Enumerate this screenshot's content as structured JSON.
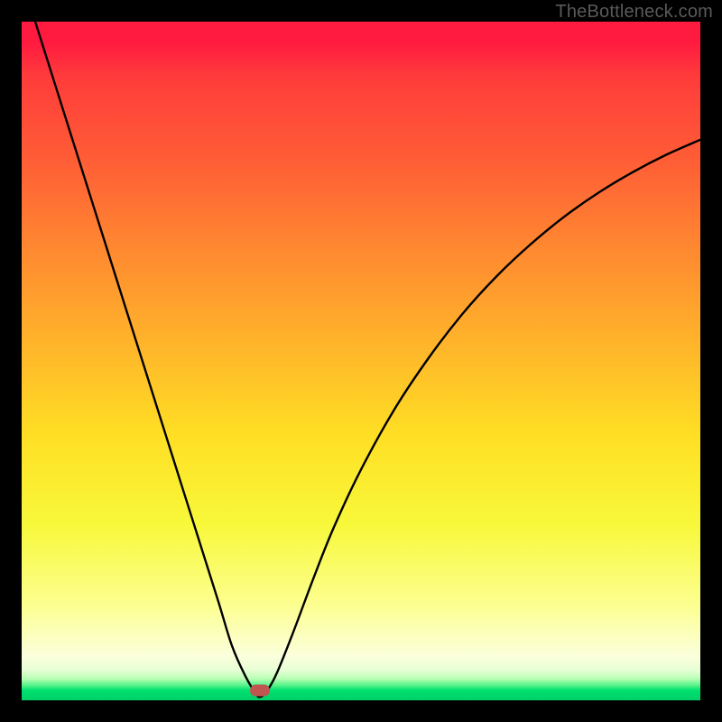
{
  "watermark": "TheBottleneck.com",
  "marker": {
    "x_pct": 35.1,
    "y_pct": 98.6
  },
  "chart_data": {
    "type": "line",
    "title": "",
    "xlabel": "",
    "ylabel": "",
    "xlim": [
      0,
      100
    ],
    "ylim": [
      0,
      100
    ],
    "grid": false,
    "legend": false,
    "series": [
      {
        "name": "bottleneck-curve",
        "x": [
          2,
          5,
          8,
          11,
          14,
          17,
          20,
          23,
          26,
          29,
          31,
          33,
          34.5,
          35.1,
          36,
          37.5,
          40,
          43,
          46,
          50,
          55,
          60,
          65,
          70,
          75,
          80,
          85,
          90,
          95,
          100
        ],
        "y": [
          100,
          90.5,
          81,
          71.5,
          62,
          52.5,
          43,
          33.5,
          24,
          14.5,
          8,
          3.5,
          1,
          0.5,
          1.2,
          3.8,
          10,
          18,
          25.5,
          34,
          43,
          50.5,
          57,
          62.5,
          67.2,
          71.3,
          74.8,
          77.8,
          80.4,
          82.6
        ]
      }
    ],
    "annotations": [
      {
        "type": "marker",
        "x": 35.1,
        "y": 0.5,
        "label": "optimal-point"
      }
    ],
    "background_gradient": {
      "top_color": "#ff1a40",
      "mid_color": "#ffdf24",
      "bottom_color": "#00cf68"
    }
  }
}
